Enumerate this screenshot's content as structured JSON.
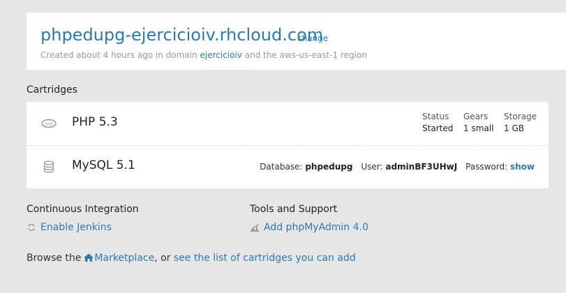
{
  "header": {
    "app_url": "phpedupg-ejercicioiv.rhcloud.com",
    "change_label": "change",
    "meta_prefix": "Created about 4 hours ago in domain ",
    "domain_link": "ejercicioiv",
    "meta_suffix": " and the aws-us-east-1 region"
  },
  "cartridges": {
    "title": "Cartridges",
    "php": {
      "icon": "php-icon",
      "name": "PHP 5.3",
      "status_label": "Status",
      "status_value": "Started",
      "gears_label": "Gears",
      "gears_value": "1 small",
      "storage_label": "Storage",
      "storage_value": "1 GB"
    },
    "mysql": {
      "icon": "database-icon",
      "name": "MySQL 5.1",
      "database_label": "Database:",
      "database_value": "phpedupg",
      "user_label": "User:",
      "user_value": "adminBF3UHwJ",
      "password_label": "Password:",
      "password_link": "show"
    }
  },
  "continuous_integration": {
    "title": "Continuous Integration",
    "enable_jenkins": "Enable Jenkins"
  },
  "tools": {
    "title": "Tools and Support",
    "add_phpmyadmin": "Add phpMyAdmin 4.0"
  },
  "browse": {
    "prefix": "Browse the ",
    "marketplace_link": "Marketplace",
    "middle": ", or ",
    "cartridges_link": "see the list of cartridges you can add"
  },
  "colors": {
    "link": "#2a7ab0",
    "background": "#e6e6e6",
    "card": "#ffffff"
  }
}
